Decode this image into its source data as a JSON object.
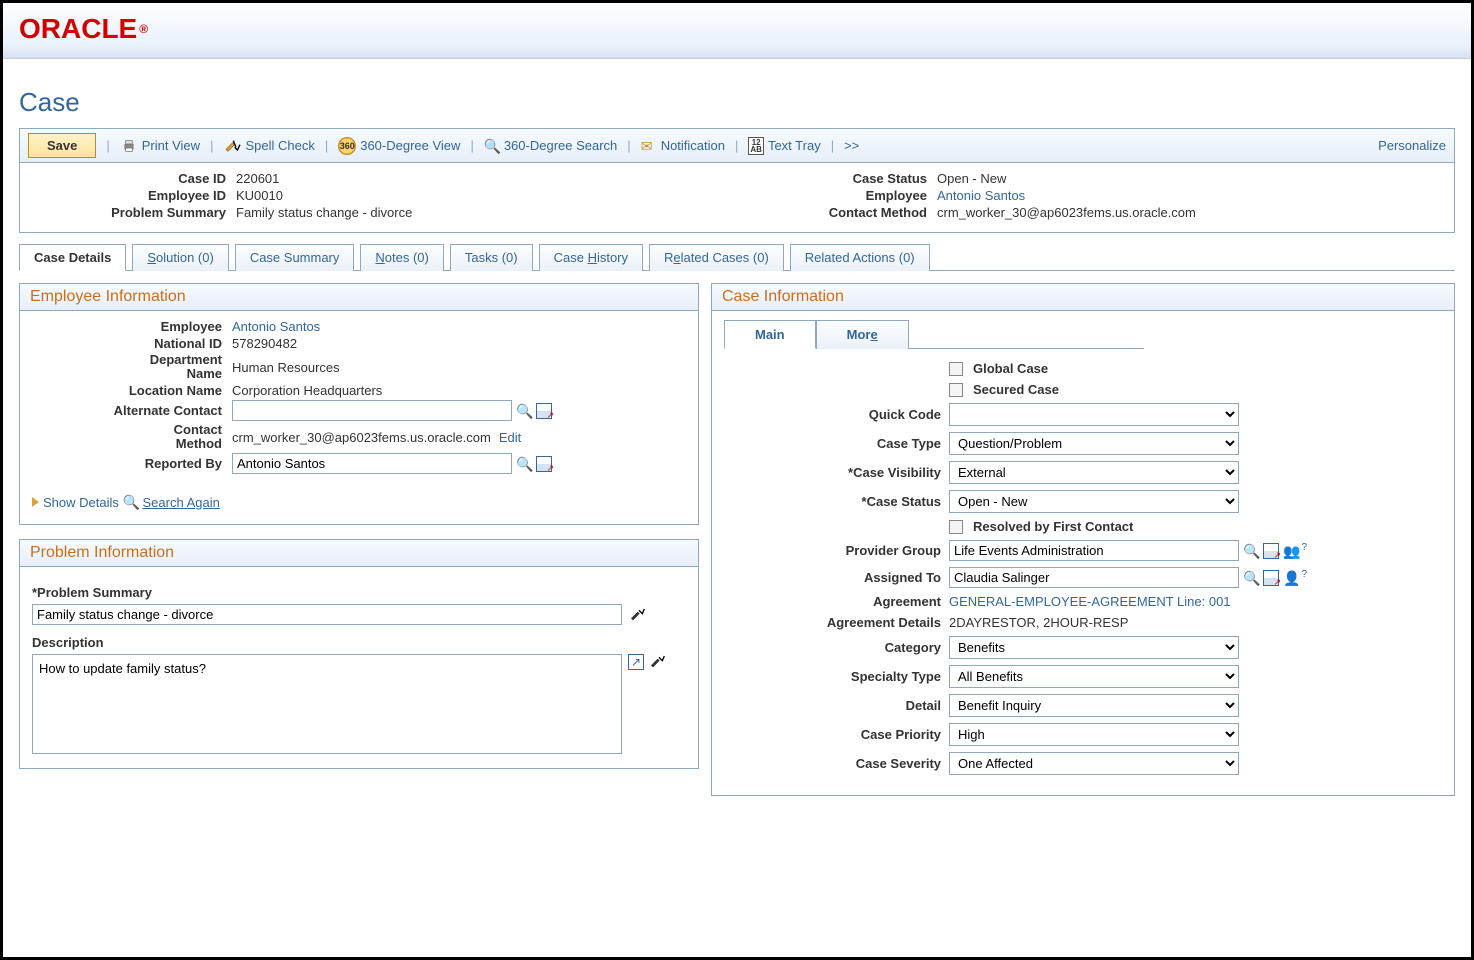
{
  "brand": "ORACLE",
  "page_title": "Case",
  "toolbar": {
    "save": "Save",
    "print_view": "Print View",
    "spell_check": "Spell Check",
    "deg_view": "360-Degree View",
    "deg_search": "360-Degree Search",
    "notification": "Notification",
    "text_tray": "Text Tray",
    "more": ">>",
    "personalize": "Personalize"
  },
  "summary": {
    "left": {
      "case_id_label": "Case ID",
      "case_id": "220601",
      "employee_id_label": "Employee ID",
      "employee_id": "KU0010",
      "problem_summary_label": "Problem Summary",
      "problem_summary": "Family status change - divorce"
    },
    "right": {
      "case_status_label": "Case Status",
      "case_status": "Open - New",
      "employee_label": "Employee",
      "employee": "Antonio Santos",
      "contact_method_label": "Contact Method",
      "contact_method": "crm_worker_30@ap6023fems.us.oracle.com"
    }
  },
  "tabs": {
    "case_details": "Case Details",
    "solution": "Solution (0)",
    "case_summary": "Case Summary",
    "notes": "Notes (0)",
    "tasks": "Tasks (0)",
    "case_history": "Case History",
    "related_cases": "Related Cases (0)",
    "related_actions": "Related Actions (0)"
  },
  "employee_info": {
    "title": "Employee Information",
    "employee_label": "Employee",
    "employee": "Antonio Santos",
    "national_id_label": "National ID",
    "national_id": "578290482",
    "department_label": "Department Name",
    "department": "Human Resources",
    "location_label": "Location Name",
    "location": "Corporation Headquarters",
    "alt_contact_label": "Alternate Contact",
    "alt_contact": "",
    "contact_method_label": "Contact Method",
    "contact_method": "crm_worker_30@ap6023fems.us.oracle.com",
    "edit": "Edit",
    "reported_by_label": "Reported By",
    "reported_by": "Antonio Santos",
    "show_details": "Show Details",
    "search_again": "Search Again"
  },
  "problem_info": {
    "title": "Problem Information",
    "problem_summary_label": "*Problem Summary",
    "problem_summary": "Family status change - divorce",
    "description_label": "Description",
    "description": "How to update family status?"
  },
  "case_info": {
    "title": "Case Information",
    "subtabs": {
      "main": "Main",
      "more": "More"
    },
    "global_case_label": "Global Case",
    "secured_case_label": "Secured Case",
    "quick_code_label": "Quick Code",
    "quick_code": "",
    "case_type_label": "Case Type",
    "case_type": "Question/Problem",
    "case_visibility_label": "*Case Visibility",
    "case_visibility": "External",
    "case_status_label": "*Case Status",
    "case_status": "Open - New",
    "resolved_first_label": "Resolved by First Contact",
    "provider_group_label": "Provider Group",
    "provider_group": "Life Events Administration",
    "assigned_to_label": "Assigned To",
    "assigned_to": "Claudia Salinger",
    "agreement_label": "Agreement",
    "agreement": "GENERAL-EMPLOYEE-AGREEMENT Line: 001",
    "agreement_details_label": "Agreement Details",
    "agreement_details": "2DAYRESTOR, 2HOUR-RESP",
    "category_label": "Category",
    "category": "Benefits",
    "specialty_label": "Specialty Type",
    "specialty": "All Benefits",
    "detail_label": "Detail",
    "detail": "Benefit Inquiry",
    "priority_label": "Case Priority",
    "priority": "High",
    "severity_label": "Case Severity",
    "severity": "One Affected"
  }
}
